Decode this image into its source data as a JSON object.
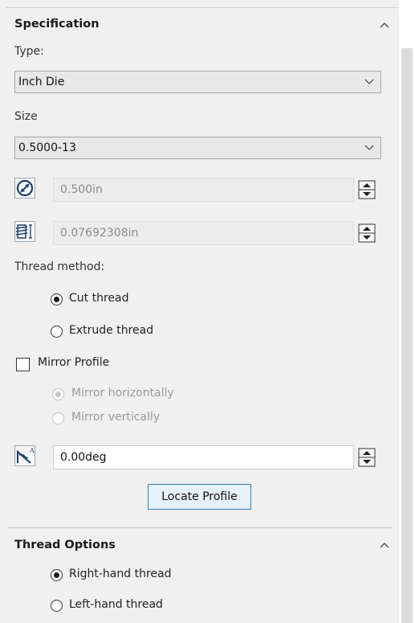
{
  "specification": {
    "title": "Specification",
    "type_label": "Type:",
    "type_value": "Inch Die",
    "size_label": "Size",
    "size_value": "0.5000-13",
    "diameter_value": "0.500in",
    "pitch_value": "0.07692308in",
    "thread_method_label": "Thread method:",
    "cut_thread_label": "Cut thread",
    "extrude_thread_label": "Extrude thread",
    "mirror_profile_label": "Mirror Profile",
    "mirror_horizontally_label": "Mirror horizontally",
    "mirror_vertically_label": "Mirror vertically",
    "angle_value": "0.00deg",
    "locate_profile_label": "Locate Profile"
  },
  "thread_options": {
    "title": "Thread Options",
    "right_hand_label": "Right-hand thread",
    "left_hand_label": "Left-hand thread"
  },
  "state": {
    "thread_method": "Cut thread",
    "mirror_profile_checked": false,
    "mirror_option": "Mirror horizontally",
    "handedness": "Right-hand thread"
  },
  "icons": {
    "collapse": "chevron-up-icon",
    "dropdown": "chevron-down-icon",
    "diameter": "diameter-icon",
    "pitch": "thread-pitch-icon",
    "angle": "rotation-angle-icon",
    "spin": "spin-button-icon"
  }
}
